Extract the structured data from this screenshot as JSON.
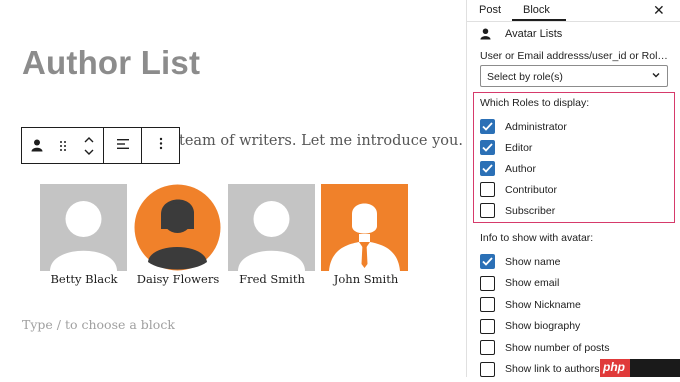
{
  "editor": {
    "title": "Author List",
    "intro": "team of writers. Let me introduce you.",
    "placeholder": "Type / to choose a block",
    "authors": [
      {
        "name": "Betty Black"
      },
      {
        "name": "Daisy Flowers"
      },
      {
        "name": "Fred Smith"
      },
      {
        "name": "John Smith"
      }
    ]
  },
  "sidebar": {
    "tabs": [
      {
        "label": "Post"
      },
      {
        "label": "Block"
      }
    ],
    "close": "✕",
    "block_name": "Avatar Lists",
    "user_field_label": "User or Email addresss/user_id or Rol…",
    "select_value": "Select by role(s)",
    "roles_label": "Which Roles to display:",
    "roles": [
      {
        "label": "Administrator",
        "checked": true
      },
      {
        "label": "Editor",
        "checked": true
      },
      {
        "label": "Author",
        "checked": true
      },
      {
        "label": "Contributor",
        "checked": false
      },
      {
        "label": "Subscriber",
        "checked": false
      }
    ],
    "info_label": "Info to show with avatar:",
    "info": [
      {
        "label": "Show name",
        "checked": true
      },
      {
        "label": "Show email",
        "checked": false
      },
      {
        "label": "Show Nickname",
        "checked": false
      },
      {
        "label": "Show biography",
        "checked": false
      },
      {
        "label": "Show number of posts",
        "checked": false
      },
      {
        "label": "Show link to authors",
        "checked": false
      }
    ]
  },
  "watermark": "php",
  "colors": {
    "accent": "#2b70b6",
    "highlight": "#d63a6b",
    "orange": "#f0812a"
  }
}
